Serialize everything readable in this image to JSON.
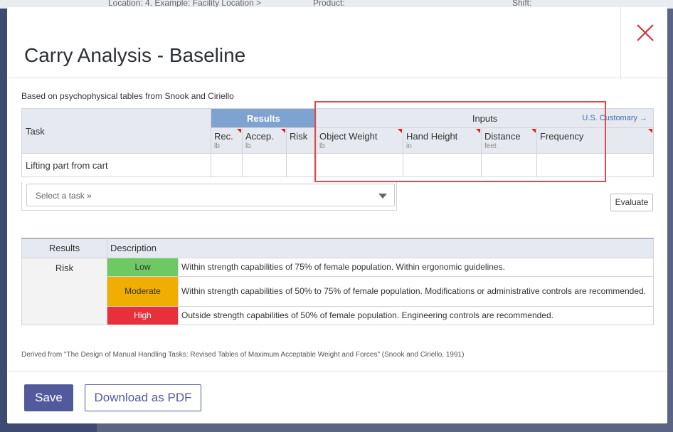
{
  "background": {
    "location_label": "Location: 4. Example: Facility Location >",
    "product_label": "Product:",
    "shift_label": "Shift:"
  },
  "modal": {
    "title": "Carry Analysis - Baseline",
    "close_icon": "close-icon",
    "source_note": "Based on psychophysical tables from Snook and Ciriello",
    "derived_note": "Derived from \"The Design of Manual Handling Tasks: Revised Tables of Maximum Acceptable Weight and Forces\" (Snook and Ciriello, 1991)"
  },
  "table": {
    "task_header": "Task",
    "results_header": "Results",
    "inputs_header": "Inputs",
    "units_link": "U.S. Customary →",
    "columns": {
      "rec": {
        "label": "Rec.",
        "unit": "lb"
      },
      "accep": {
        "label": "Accep.",
        "unit": "lb"
      },
      "risk": {
        "label": "Risk",
        "unit": ""
      },
      "object_weight": {
        "label": "Object Weight",
        "unit": "lb"
      },
      "hand_height": {
        "label": "Hand Height",
        "unit": "in"
      },
      "distance": {
        "label": "Distance",
        "unit": "feet"
      },
      "frequency": {
        "label": "Frequency",
        "unit": ""
      }
    },
    "rows": [
      {
        "task": "Lifting part from cart",
        "rec": "",
        "accep": "",
        "risk": "",
        "object_weight": "",
        "hand_height": "",
        "distance": "",
        "frequency": ""
      }
    ]
  },
  "task_select": {
    "placeholder": "Select a task »"
  },
  "evaluate_label": "Evaluate",
  "legend": {
    "results_header": "Results",
    "description_header": "Description",
    "risk_label": "Risk",
    "levels": [
      {
        "level": "Low",
        "color": "#6cc964",
        "description": "Within strength capabilities of 75% of female population. Within ergonomic guidelines."
      },
      {
        "level": "Moderate",
        "color": "#f0ae00",
        "description": "Within strength capabilities of 50% to 75% of female population. Modifications or administrative controls are recommended."
      },
      {
        "level": "High",
        "color": "#e8303a",
        "description": "Outside strength capabilities of 50% of female population. Engineering controls are recommended."
      }
    ]
  },
  "footer": {
    "save_label": "Save",
    "pdf_label": "Download as PDF"
  },
  "colors": {
    "accent": "#525a9c",
    "results_header": "#7fa3d0",
    "highlight": "#e0484d"
  }
}
